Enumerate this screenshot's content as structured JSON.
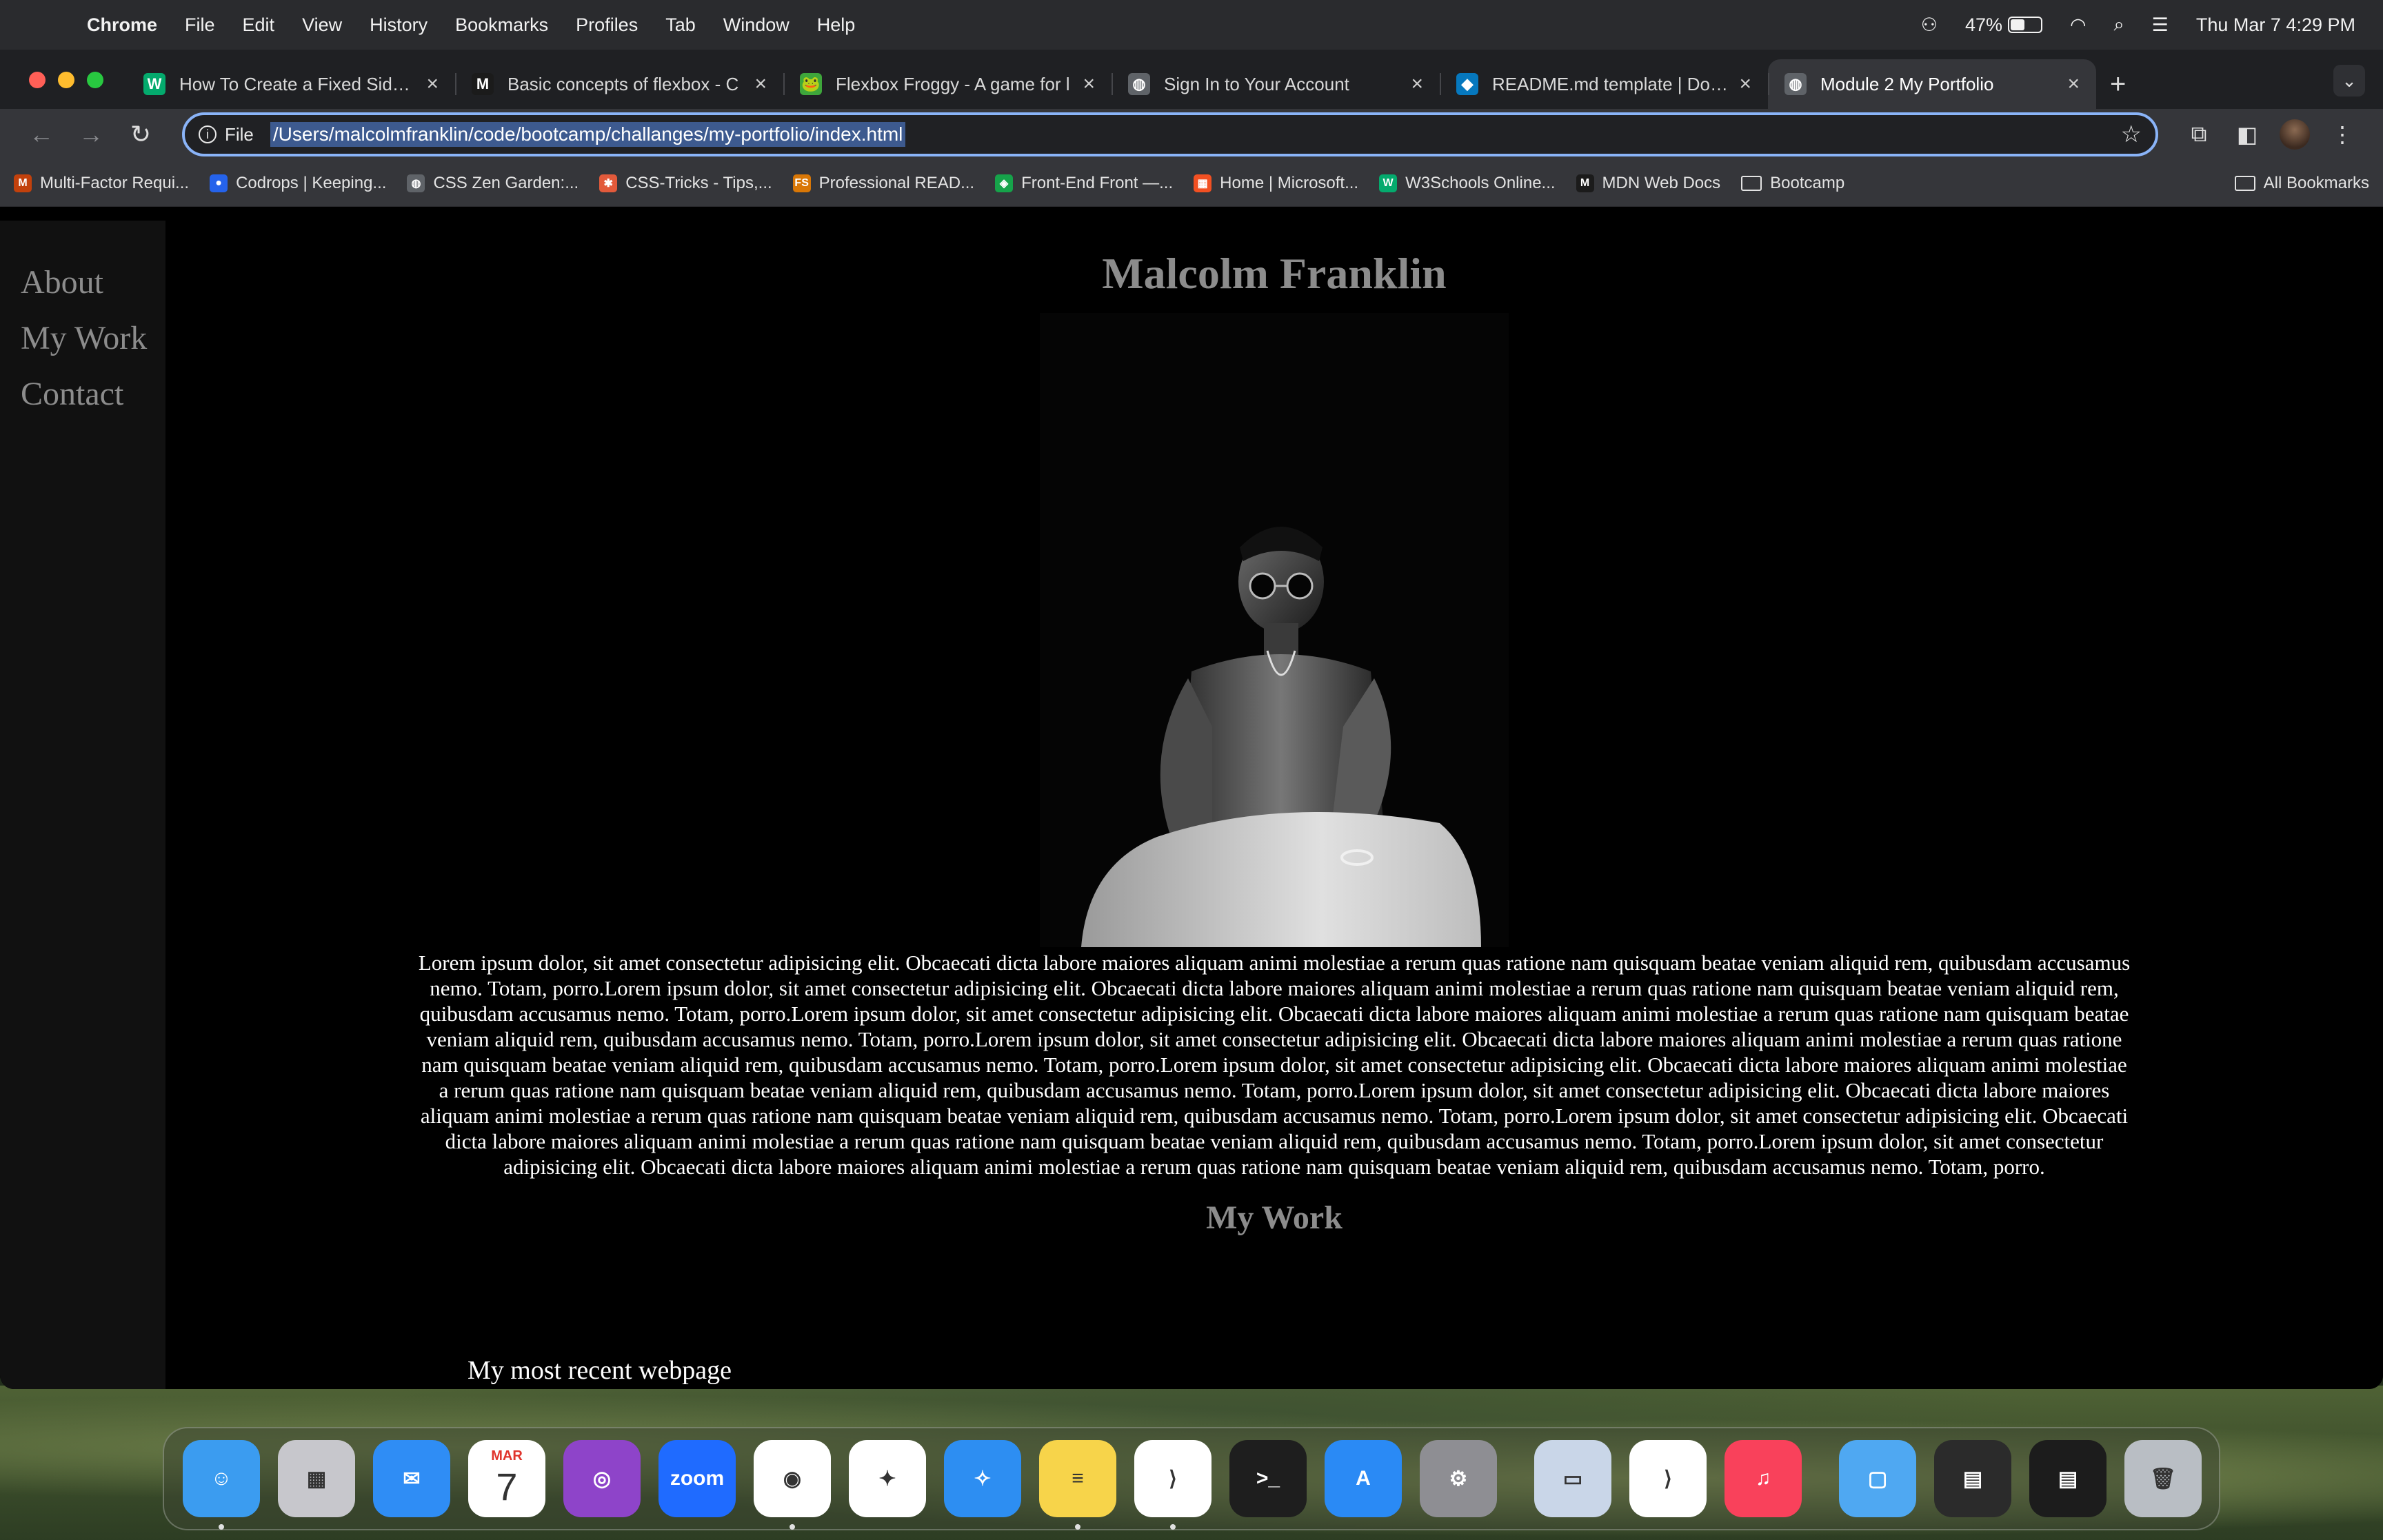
{
  "menubar": {
    "apple": "",
    "app_name": "Chrome",
    "items": [
      "File",
      "Edit",
      "View",
      "History",
      "Bookmarks",
      "Profiles",
      "Tab",
      "Window",
      "Help"
    ],
    "battery_percent": "47%",
    "battery_level": 0.47,
    "datetime": "Thu Mar 7  4:29 PM"
  },
  "tabs": [
    {
      "title": "How To Create a Fixed Sideba",
      "icon": "w3schools-icon",
      "color": "#04aa6d",
      "glyph": "W"
    },
    {
      "title": "Basic concepts of flexbox - C",
      "icon": "mdn-icon",
      "color": "#1b1b1b",
      "glyph": "M"
    },
    {
      "title": "Flexbox Froggy - A game for l",
      "icon": "froggy-icon",
      "color": "#3ea63b",
      "glyph": "🐸"
    },
    {
      "title": "Sign In to Your Account",
      "icon": "globe-icon",
      "color": "#5f6368",
      "glyph": "◍"
    },
    {
      "title": "README.md template | Docum",
      "icon": "drupal-icon",
      "color": "#0678be",
      "glyph": "◆"
    },
    {
      "title": "Module 2 My Portfolio",
      "icon": "globe-icon",
      "color": "#5f6368",
      "glyph": "◍"
    }
  ],
  "active_tab": 5,
  "omnibox": {
    "scheme_label": "File",
    "url": "/Users/malcolmfranklin/code/bootcamp/challanges/my-portfolio/index.html"
  },
  "bookmarks": [
    {
      "label": "Multi-Factor Requi...",
      "color": "#c2410c",
      "glyph": "M"
    },
    {
      "label": "Codrops | Keeping...",
      "color": "#2563eb",
      "glyph": "●"
    },
    {
      "label": "CSS Zen Garden:...",
      "color": "#5f6368",
      "glyph": "◍"
    },
    {
      "label": "CSS-Tricks - Tips,...",
      "color": "#e25a3b",
      "glyph": "✱"
    },
    {
      "label": "Professional READ...",
      "color": "#d97706",
      "glyph": "FS"
    },
    {
      "label": "Front-End Front —...",
      "color": "#16a34a",
      "glyph": "◈"
    },
    {
      "label": "Home | Microsoft...",
      "color": "#f25022",
      "glyph": "▦"
    },
    {
      "label": "W3Schools Online...",
      "color": "#04aa6d",
      "glyph": "W"
    },
    {
      "label": "MDN Web Docs",
      "color": "#1b1b1b",
      "glyph": "M"
    },
    {
      "label": "Bootcamp",
      "color": "",
      "glyph": ""
    }
  ],
  "all_bookmarks": "All Bookmarks",
  "page": {
    "sidebar": [
      "About",
      "My Work",
      "Contact"
    ],
    "heading": "Malcolm Franklin",
    "bio": "Lorem ipsum dolor, sit amet consectetur adipisicing elit. Obcaecati dicta labore maiores aliquam animi molestiae a rerum quas ratione nam quisquam beatae veniam aliquid rem, quibusdam accusamus nemo. Totam, porro.Lorem ipsum dolor, sit amet consectetur adipisicing elit. Obcaecati dicta labore maiores aliquam animi molestiae a rerum quas ratione nam quisquam beatae veniam aliquid rem, quibusdam accusamus nemo. Totam, porro.Lorem ipsum dolor, sit amet consectetur adipisicing elit. Obcaecati dicta labore maiores aliquam animi molestiae a rerum quas ratione nam quisquam beatae veniam aliquid rem, quibusdam accusamus nemo. Totam, porro.Lorem ipsum dolor, sit amet consectetur adipisicing elit. Obcaecati dicta labore maiores aliquam animi molestiae a rerum quas ratione nam quisquam beatae veniam aliquid rem, quibusdam accusamus nemo. Totam, porro.Lorem ipsum dolor, sit amet consectetur adipisicing elit. Obcaecati dicta labore maiores aliquam animi molestiae a rerum quas ratione nam quisquam beatae veniam aliquid rem, quibusdam accusamus nemo. Totam, porro.Lorem ipsum dolor, sit amet consectetur adipisicing elit. Obcaecati dicta labore maiores aliquam animi molestiae a rerum quas ratione nam quisquam beatae veniam aliquid rem, quibusdam accusamus nemo. Totam, porro.Lorem ipsum dolor, sit amet consectetur adipisicing elit. Obcaecati dicta labore maiores aliquam animi molestiae a rerum quas ratione nam quisquam beatae veniam aliquid rem, quibusdam accusamus nemo. Totam, porro.Lorem ipsum dolor, sit amet consectetur adipisicing elit. Obcaecati dicta labore maiores aliquam animi molestiae a rerum quas ratione nam quisquam beatae veniam aliquid rem, quibusdam accusamus nemo. Totam, porro.",
    "work_heading": "My Work",
    "work_subheading": "My most recent webpage"
  },
  "dock": [
    {
      "name": "finder-icon",
      "color": "#3b9cf0",
      "glyph": "☺",
      "running": true
    },
    {
      "name": "launchpad-icon",
      "color": "#c7c7cc",
      "glyph": "▦",
      "running": false
    },
    {
      "name": "mail-icon",
      "color": "#2f8df5",
      "glyph": "✉",
      "running": false
    },
    {
      "name": "calendar-icon",
      "color": "#ffffff",
      "glyph": "7",
      "running": false,
      "month": "MAR"
    },
    {
      "name": "github-desktop-icon",
      "color": "#8e44c9",
      "glyph": "◎",
      "running": false
    },
    {
      "name": "zoom-icon",
      "color": "#1f6bff",
      "glyph": "zoom",
      "running": false
    },
    {
      "name": "chrome-icon",
      "color": "#ffffff",
      "glyph": "◉",
      "running": true
    },
    {
      "name": "slack-icon",
      "color": "#ffffff",
      "glyph": "✦",
      "running": false
    },
    {
      "name": "safari-icon",
      "color": "#2d8ef2",
      "glyph": "✧",
      "running": false
    },
    {
      "name": "notes-icon",
      "color": "#f7d44a",
      "glyph": "≡",
      "running": true
    },
    {
      "name": "vscode-icon",
      "color": "#ffffff",
      "glyph": "⟩",
      "running": true
    },
    {
      "name": "terminal-icon",
      "color": "#1e1e1e",
      "glyph": ">_",
      "running": false
    },
    {
      "name": "app-store-icon",
      "color": "#2a8af5",
      "glyph": "A",
      "running": false
    },
    {
      "name": "system-settings-icon",
      "color": "#8e8e93",
      "glyph": "⚙",
      "running": false
    },
    {
      "name": "preview-icon",
      "color": "#c9d6e8",
      "glyph": "▭",
      "running": false
    },
    {
      "name": "vscode-insiders-icon",
      "color": "#ffffff",
      "glyph": "⟩",
      "running": false
    },
    {
      "name": "music-icon",
      "color": "#f9415b",
      "glyph": "♫",
      "running": false
    },
    {
      "name": "downloads-folder-icon",
      "color": "#4fa8f2",
      "glyph": "▢",
      "running": false
    },
    {
      "name": "recent-window-icon",
      "color": "#2b2b2b",
      "glyph": "▤",
      "running": false
    },
    {
      "name": "recent-window-2-icon",
      "color": "#1c1c1c",
      "glyph": "▤",
      "running": false
    },
    {
      "name": "trash-icon",
      "color": "#b9bec4",
      "glyph": "🗑",
      "running": false
    }
  ],
  "colors": {
    "accent_focus": "#8ab4f8",
    "sidebar_bg": "#111111",
    "heading_gray": "#8c8c8c"
  }
}
